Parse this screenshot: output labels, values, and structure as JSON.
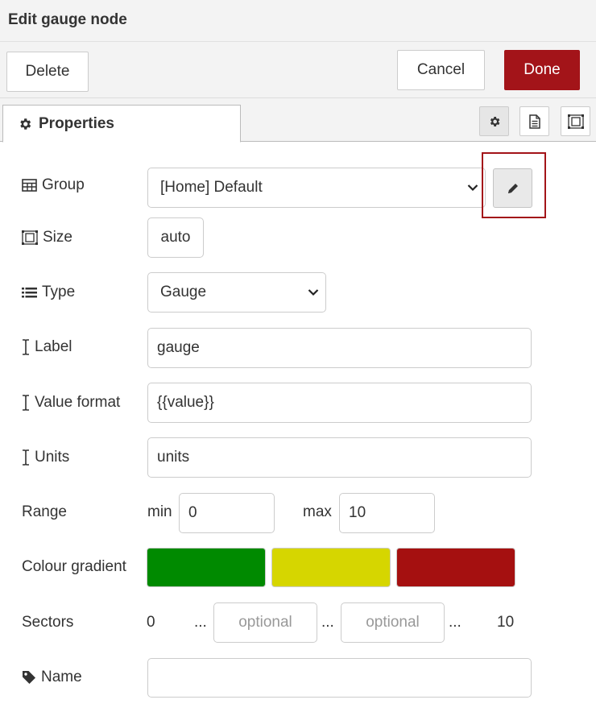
{
  "title": "Edit gauge node",
  "buttons": {
    "delete": "Delete",
    "cancel": "Cancel",
    "done": "Done"
  },
  "tabs": {
    "properties": "Properties"
  },
  "form": {
    "group": {
      "label": "Group",
      "value": "[Home] Default"
    },
    "size": {
      "label": "Size",
      "value": "auto"
    },
    "type": {
      "label": "Type",
      "value": "Gauge"
    },
    "label": {
      "label": "Label",
      "value": "gauge"
    },
    "value_format": {
      "label": "Value format",
      "value": "{{value}}"
    },
    "units": {
      "label": "Units",
      "value": "units"
    },
    "range": {
      "label": "Range",
      "min_label": "min",
      "min_value": "0",
      "max_label": "max",
      "max_value": "10"
    },
    "colour_gradient": {
      "label": "Colour gradient",
      "colors": [
        "#008a00",
        "#d6d600",
        "#a51010"
      ]
    },
    "sectors": {
      "label": "Sectors",
      "start": "0",
      "sep": "...",
      "placeholder_1": "optional",
      "placeholder_2": "optional",
      "end": "10"
    },
    "name": {
      "label": "Name",
      "value": ""
    }
  },
  "icons": {
    "settings": "gear-icon",
    "description": "file-text-icon",
    "appearance": "object-group-icon",
    "edit": "pencil-icon",
    "group": "table-icon",
    "size": "object-group-icon",
    "type": "list-icon",
    "text": "i-cursor-icon",
    "tag": "tag-icon"
  }
}
